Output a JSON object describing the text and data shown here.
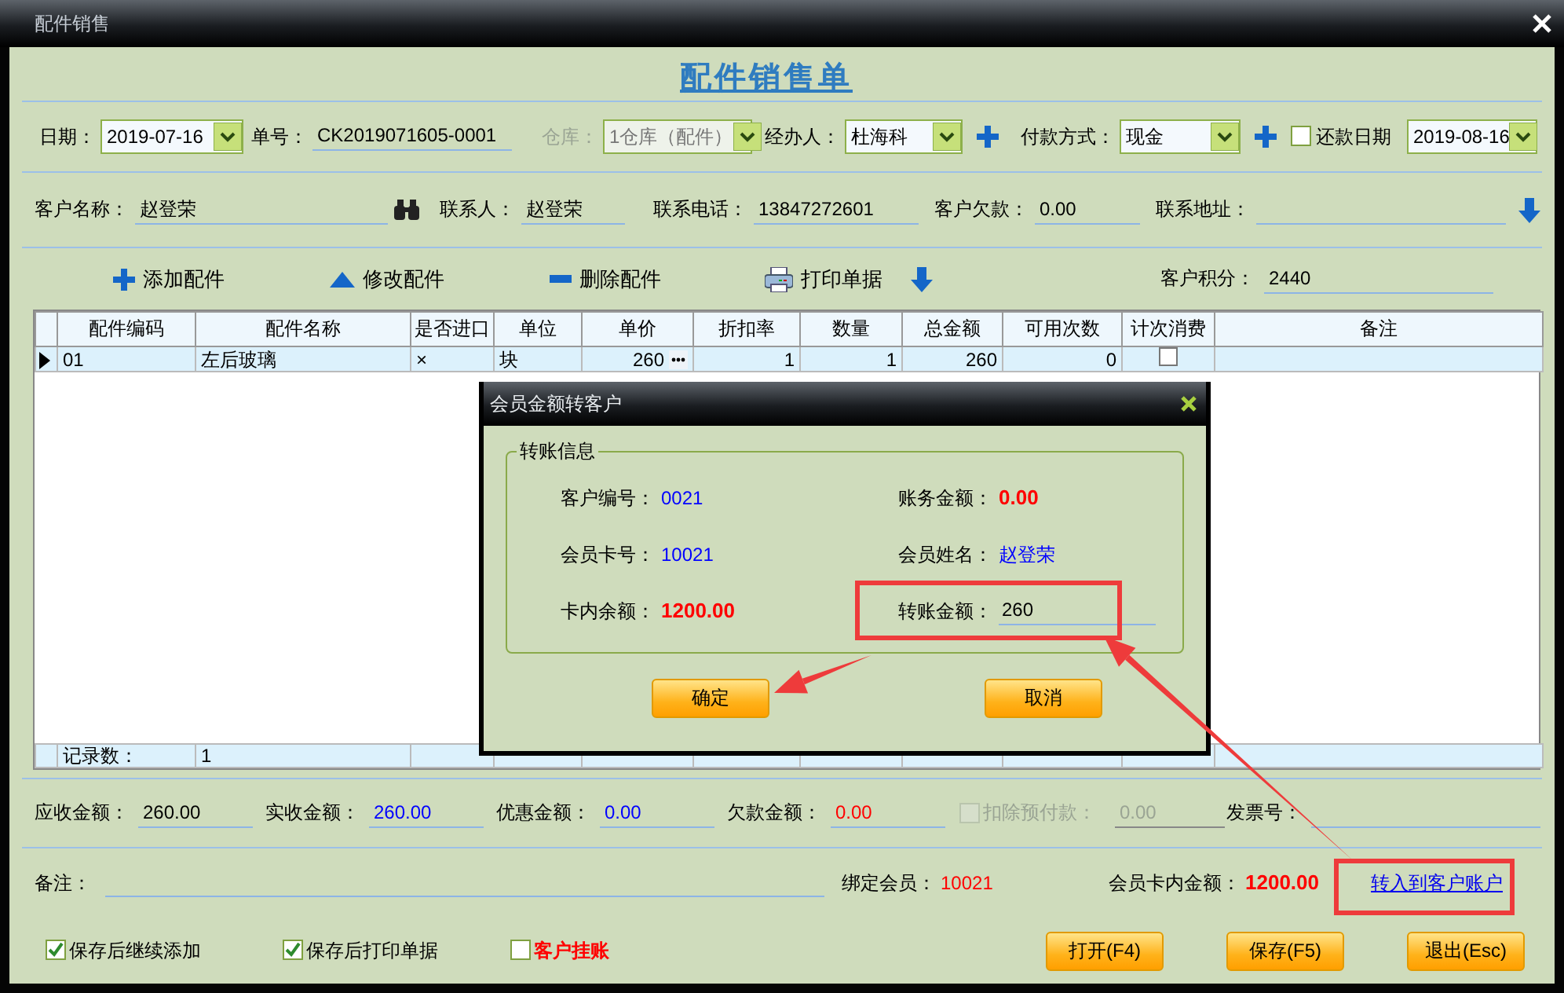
{
  "window": {
    "title": "配件销售"
  },
  "form_title": "配件销售单",
  "header_row_1": [
    {
      "kind": "select",
      "label": "日期：",
      "value": "2019-07-16",
      "disabled": false
    },
    {
      "kind": "text",
      "label": "单号：",
      "value": "CK2019071605-0001"
    },
    {
      "kind": "select",
      "label": "仓库：",
      "value": "1仓库（配件）",
      "disabled": true
    },
    {
      "kind": "select",
      "label": "经办人：",
      "value": "杜海科",
      "disabled": false,
      "add": true
    },
    {
      "kind": "select",
      "label": "付款方式：",
      "value": "现金",
      "disabled": false,
      "add": true
    },
    {
      "kind": "check",
      "label": "还款日期",
      "checked": false
    },
    {
      "kind": "select",
      "value": "2019-08-16",
      "disabled": false
    }
  ],
  "header_row_2": [
    {
      "kind": "lookup",
      "label": "客户名称：",
      "value": "赵登荣"
    },
    {
      "kind": "text",
      "label": "联系人：",
      "value": "赵登荣"
    },
    {
      "kind": "text",
      "label": "联系电话：",
      "value": "13847272601"
    },
    {
      "kind": "text",
      "label": "客户欠款：",
      "value": "0.00"
    },
    {
      "kind": "expand",
      "label": "联系地址："
    }
  ],
  "toolbar": [
    {
      "kind": "add",
      "label": "添加配件"
    },
    {
      "kind": "edit",
      "label": "修改配件"
    },
    {
      "kind": "delete",
      "label": "删除配件"
    },
    {
      "kind": "print",
      "label": "打印单据"
    },
    {
      "kind": "down"
    }
  ],
  "points": {
    "label": "客户积分：",
    "value": "2440"
  },
  "table": {
    "columns": [
      "配件编码",
      "配件名称",
      "是否进口",
      "单位",
      "单价",
      "折扣率",
      "数量",
      "总金额",
      "可用次数",
      "计次消费",
      "备注"
    ],
    "rows": [
      {
        "current": true,
        "cells": [
          "01",
          "左后玻璃",
          "×",
          "块",
          "260",
          "1",
          "1",
          "260",
          "0"
        ],
        "metered": false
      }
    ],
    "footer": {
      "label": "记录数：",
      "count": "1"
    }
  },
  "totals": [
    {
      "kind": "field",
      "label": "应收金额：",
      "value": "260.00",
      "color": "#000000"
    },
    {
      "kind": "field",
      "label": "实收金额：",
      "value": "260.00",
      "color": "#0000ff"
    },
    {
      "kind": "field",
      "label": "优惠金额：",
      "value": "0.00",
      "color": "#0000ff"
    },
    {
      "kind": "field",
      "label": "欠款金额：",
      "value": "0.00",
      "color": "#ff0000"
    },
    {
      "kind": "check",
      "label": "扣除预付款：",
      "value": "0.00",
      "checked": false,
      "disabled": true
    },
    {
      "kind": "field",
      "label": "发票号："
    }
  ],
  "remarks": {
    "label": "备注："
  },
  "member": {
    "label": "绑定会员：",
    "value": "10021"
  },
  "card_balance": {
    "label": "会员卡内金额：",
    "value": "1200.00"
  },
  "transfer_link": "转入到客户账户",
  "options": [
    {
      "label": "保存后继续添加",
      "checked": true,
      "alert": false
    },
    {
      "label": "保存后打印单据",
      "checked": true,
      "alert": false
    },
    {
      "label": "客户挂账",
      "checked": false,
      "alert": true
    }
  ],
  "buttons": [
    "打开(F4)",
    "保存(F5)",
    "退出(Esc)"
  ],
  "dialog": {
    "title": "会员金额转客户",
    "group": "转账信息",
    "fields": [
      {
        "kind": "id",
        "label": "客户编号：",
        "value": "0021"
      },
      {
        "kind": "amount",
        "label": "账务金额：",
        "value": "0.00"
      },
      {
        "kind": "id",
        "label": "会员卡号：",
        "value": "10021"
      },
      {
        "kind": "id",
        "label": "会员姓名：",
        "value": "赵登荣"
      },
      {
        "kind": "amount",
        "label": "卡内余额：",
        "value": "1200.00"
      },
      {
        "kind": "input",
        "label": "转账金额：",
        "value": "260"
      }
    ],
    "buttons": [
      "确定",
      "取消"
    ]
  }
}
